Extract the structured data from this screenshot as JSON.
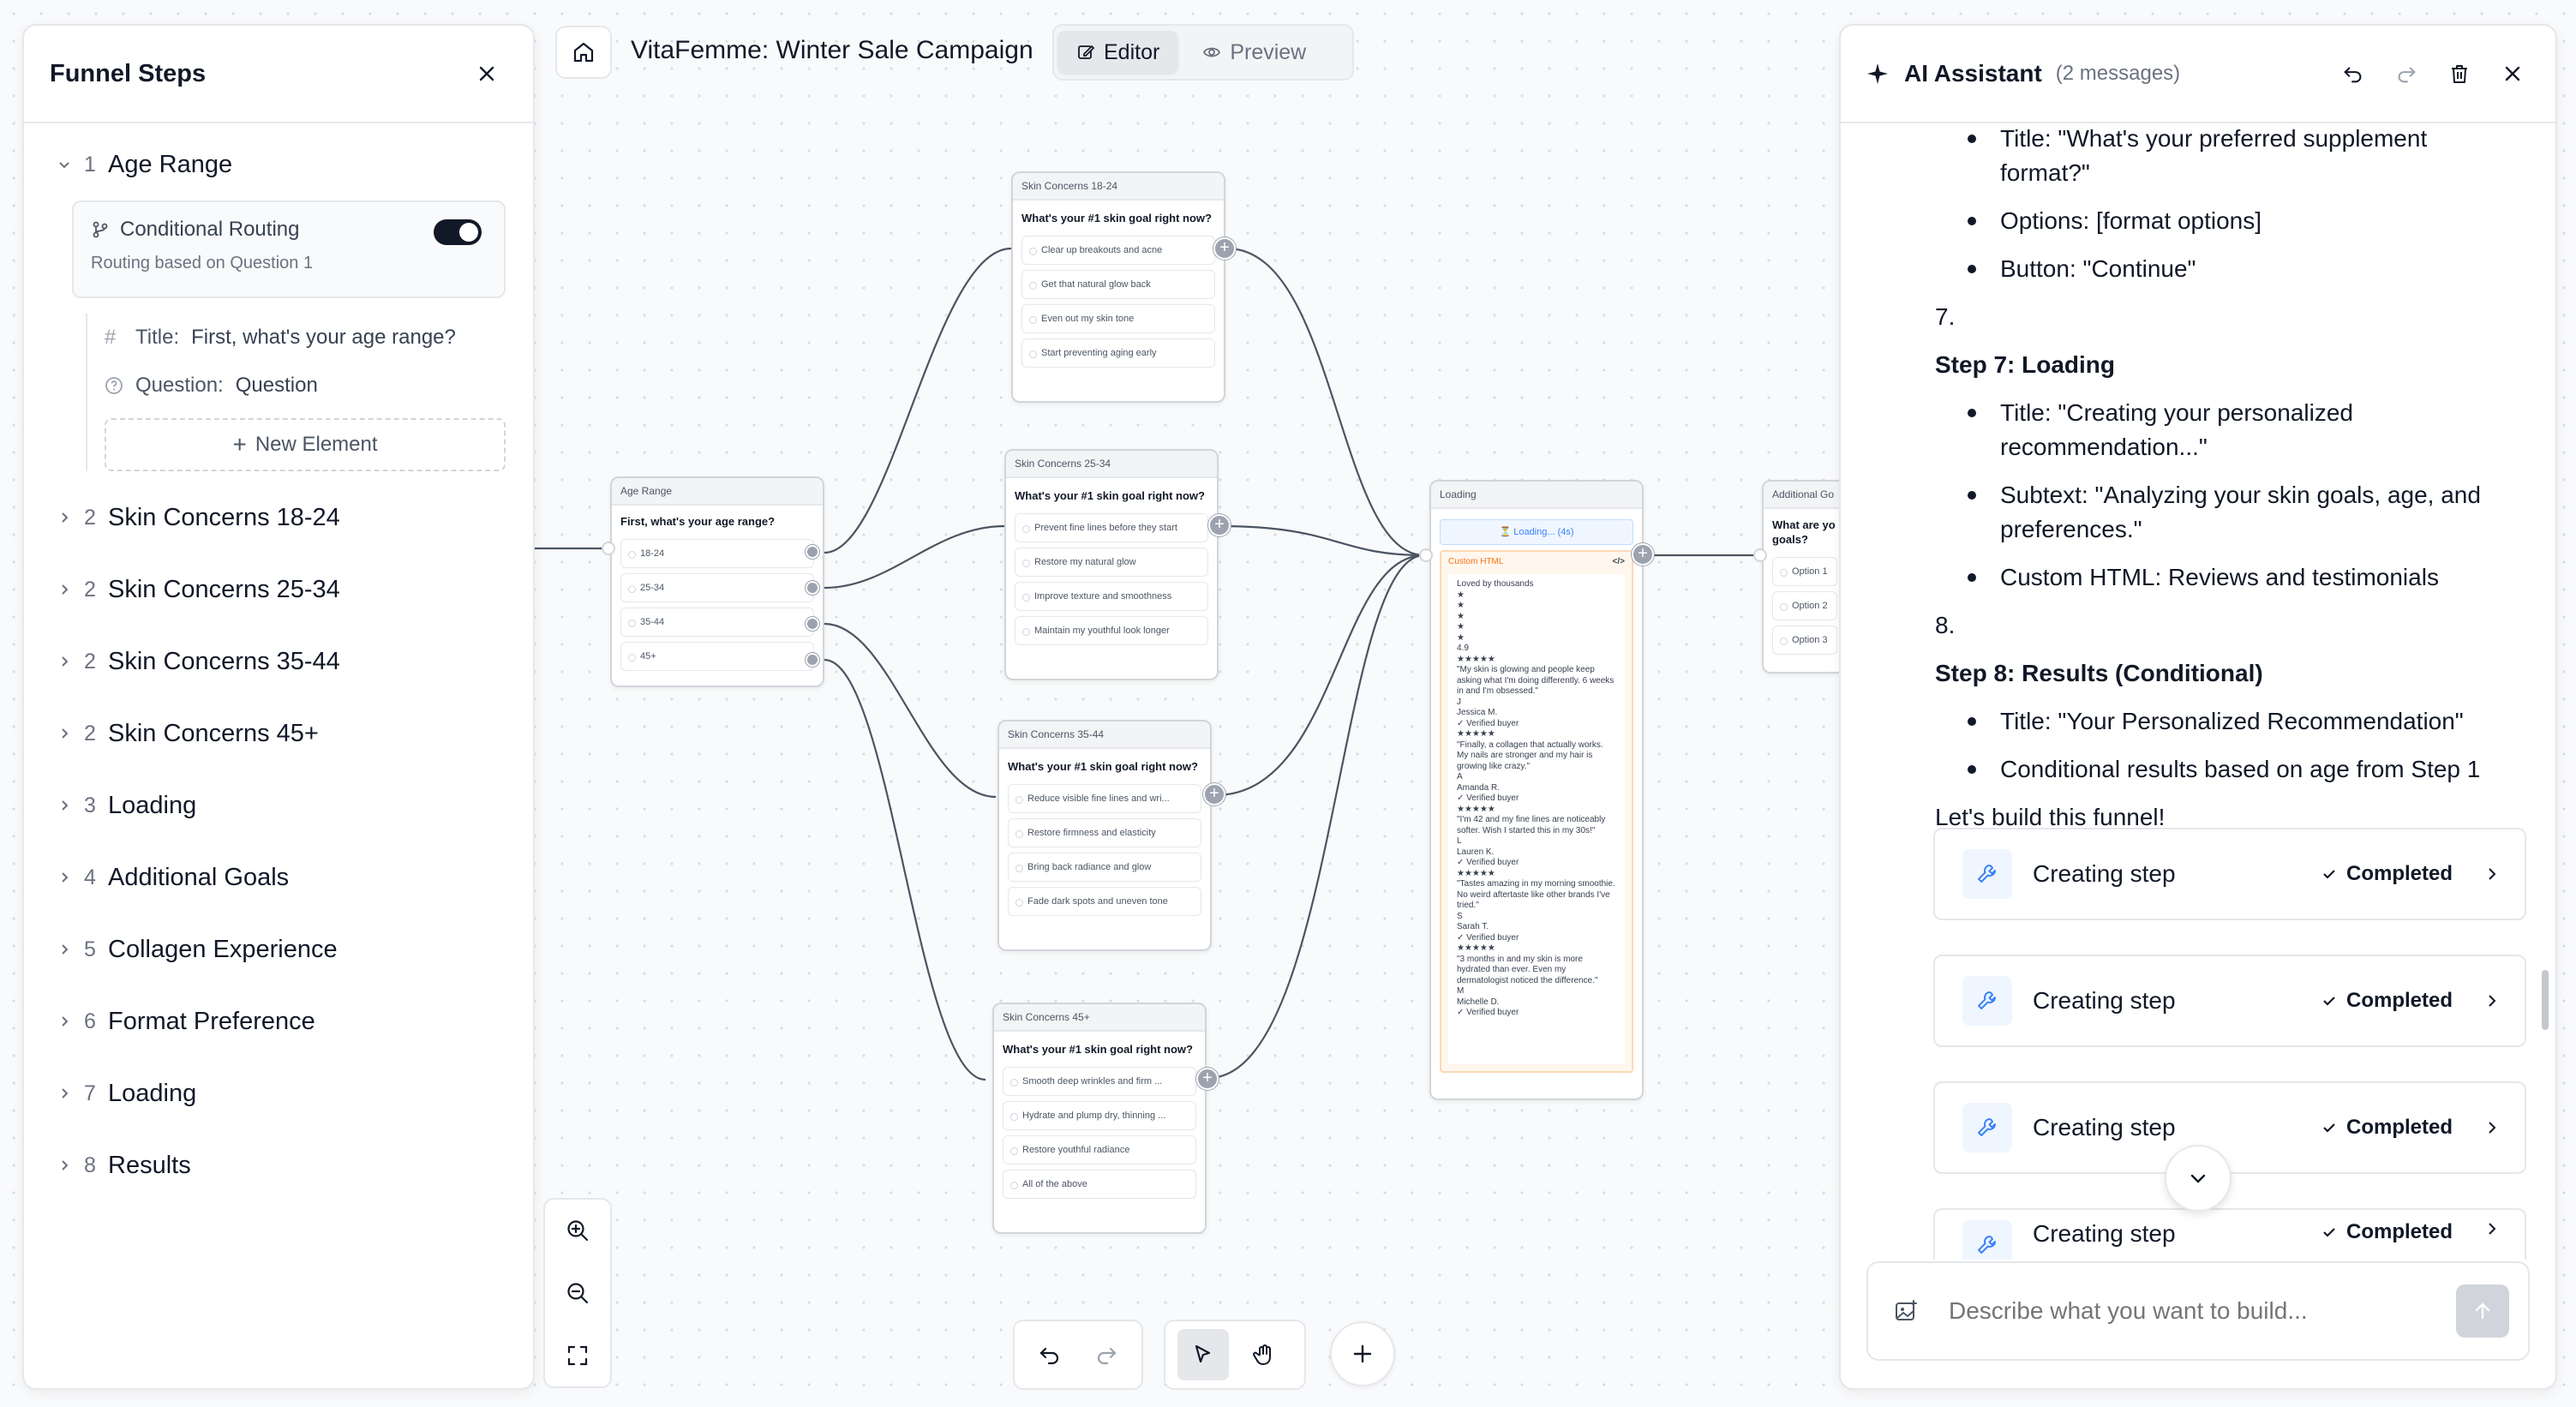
{
  "app": {
    "title": "VitaFemme: Winter Sale Campaign"
  },
  "modes": [
    {
      "label": "Editor",
      "active": true
    },
    {
      "label": "Preview",
      "active": false
    }
  ],
  "funnel": {
    "title": "Funnel Steps",
    "expanded": {
      "number": "1",
      "name": "Age Range",
      "routing": {
        "label": "Conditional Routing",
        "sub": "Routing based on Question 1",
        "enabled": true
      },
      "elements": [
        {
          "key": "Title:",
          "value": "First, what's your age range?"
        },
        {
          "key": "Question:",
          "value": "Question"
        }
      ],
      "new_element": "New Element"
    },
    "steps": [
      {
        "number": "2",
        "name": "Skin Concerns 18-24"
      },
      {
        "number": "2",
        "name": "Skin Concerns 25-34"
      },
      {
        "number": "2",
        "name": "Skin Concerns 35-44"
      },
      {
        "number": "2",
        "name": "Skin Concerns 45+"
      },
      {
        "number": "3",
        "name": "Loading"
      },
      {
        "number": "4",
        "name": "Additional Goals"
      },
      {
        "number": "5",
        "name": "Collagen Experience"
      },
      {
        "number": "6",
        "name": "Format Preference"
      },
      {
        "number": "7",
        "name": "Loading"
      },
      {
        "number": "8",
        "name": "Results"
      }
    ]
  },
  "nodes": {
    "age": {
      "title": "Age Range",
      "question": "First, what's your age range?",
      "options": [
        "18-24",
        "25-34",
        "35-44",
        "45+"
      ]
    },
    "sc1824": {
      "title": "Skin Concerns 18-24",
      "question": "What's your #1 skin goal right now?",
      "options": [
        "Clear up breakouts and acne",
        "Get that natural glow back",
        "Even out my skin tone",
        "Start preventing aging early"
      ]
    },
    "sc2534": {
      "title": "Skin Concerns 25-34",
      "question": "What's your #1 skin goal right now?",
      "options": [
        "Prevent fine lines before they start",
        "Restore my natural glow",
        "Improve texture and smoothness",
        "Maintain my youthful look longer"
      ]
    },
    "sc3544": {
      "title": "Skin Concerns 35-44",
      "question": "What's your #1 skin goal right now?",
      "options": [
        "Reduce visible fine lines and wri...",
        "Restore firmness and elasticity",
        "Bring back radiance and glow",
        "Fade dark spots and uneven tone"
      ]
    },
    "sc45": {
      "title": "Skin Concerns 45+",
      "question": "What's your #1 skin goal right now?",
      "options": [
        "Smooth deep wrinkles and firm ...",
        "Hydrate and plump dry, thinning ...",
        "Restore youthful radiance",
        "All of the above"
      ]
    },
    "loading": {
      "title": "Loading",
      "pill": "⏳ Loading... (4s)",
      "custom_label": "Custom HTML",
      "code_icon": "</>",
      "lines": [
        "Loved by thousands",
        "★",
        "★",
        "★",
        "★",
        "★",
        "4.9",
        "★★★★★",
        "\"My skin is glowing and people keep asking what I'm doing differently. 6 weeks in and I'm obsessed.\"",
        "J",
        "Jessica M.",
        "✓ Verified buyer",
        "★★★★★",
        "\"Finally, a collagen that actually works. My nails are stronger and my hair is growing like crazy.\"",
        "A",
        "Amanda R.",
        "✓ Verified buyer",
        "★★★★★",
        "\"I'm 42 and my fine lines are noticeably softer. Wish I started this in my 30s!\"",
        "L",
        "Lauren K.",
        "✓ Verified buyer",
        "★★★★★",
        "\"Tastes amazing in my morning smoothie. No weird aftertaste like other brands I've tried.\"",
        "S",
        "Sarah T.",
        "✓ Verified buyer",
        "★★★★★",
        "\"3 months in and my skin is more hydrated than ever. Even my dermatologist noticed the difference.\"",
        "M",
        "Michelle D.",
        "✓ Verified buyer"
      ]
    },
    "additional": {
      "title": "Additional Go",
      "question": "What are yo goals?",
      "options": [
        "Option 1",
        "Option 2",
        "Option 3"
      ]
    }
  },
  "assistant": {
    "title": "AI Assistant",
    "count": "(2 messages)",
    "blocks": [
      {
        "kind": "bullet",
        "text": "Title: \"What's your preferred supplement format?\""
      },
      {
        "kind": "bullet",
        "text": "Options: [format options]"
      },
      {
        "kind": "bullet",
        "text": "Button: \"Continue\""
      },
      {
        "kind": "num",
        "text": "7."
      },
      {
        "kind": "heading",
        "text": "Step 7: Loading"
      },
      {
        "kind": "bullet",
        "text": "Title: \"Creating your personalized recommendation...\""
      },
      {
        "kind": "bullet",
        "text": "Subtext: \"Analyzing your skin goals, age, and preferences.\""
      },
      {
        "kind": "bullet",
        "text": "Custom HTML: Reviews and testimonials"
      },
      {
        "kind": "num",
        "text": "8."
      },
      {
        "kind": "heading",
        "text": "Step 8: Results (Conditional)"
      },
      {
        "kind": "bullet",
        "text": "Title: \"Your Personalized Recommendation\""
      },
      {
        "kind": "bullet",
        "text": "Conditional results based on age from Step 1"
      },
      {
        "kind": "para",
        "text": "Let's build this funnel!"
      }
    ],
    "tool_calls": [
      {
        "label": "Creating step",
        "status": "Completed"
      },
      {
        "label": "Creating step",
        "status": "Completed"
      },
      {
        "label": "Creating step",
        "status": "Completed"
      },
      {
        "label": "Creating step",
        "status": "Completed"
      }
    ],
    "composer_placeholder": "Describe what you want to build..."
  }
}
